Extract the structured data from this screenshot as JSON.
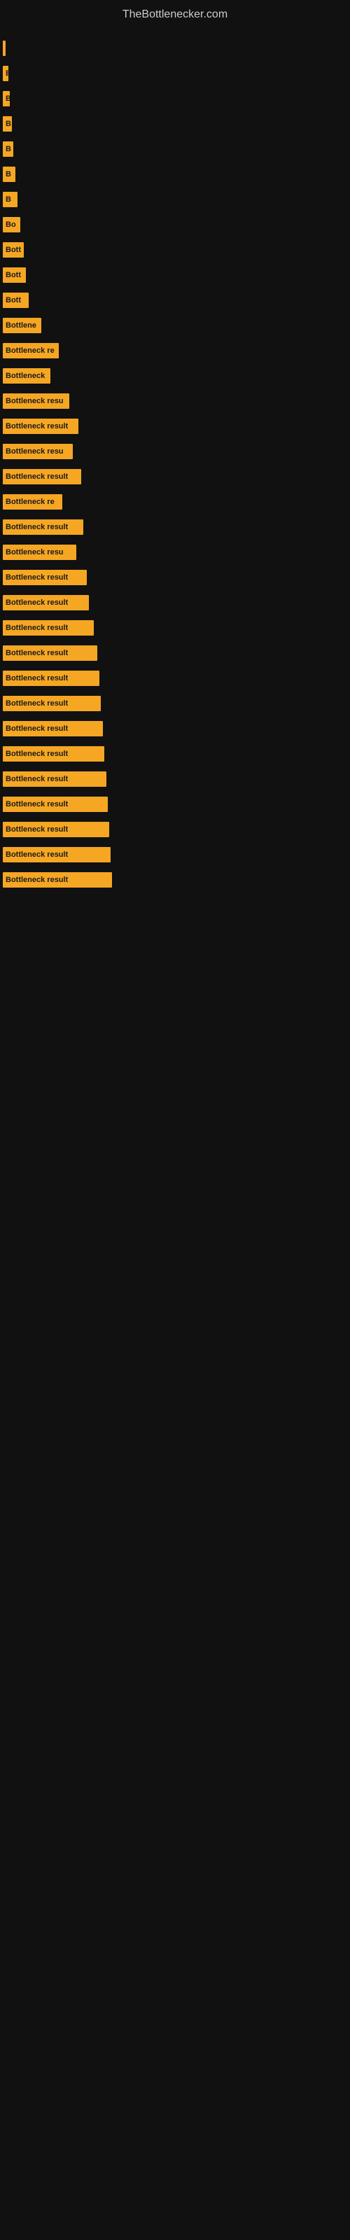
{
  "site": {
    "title": "TheBottlenecker.com"
  },
  "bars": [
    {
      "label": "|",
      "width": 4
    },
    {
      "label": "B",
      "width": 8
    },
    {
      "label": "B",
      "width": 10
    },
    {
      "label": "B",
      "width": 13
    },
    {
      "label": "B",
      "width": 15
    },
    {
      "label": "B",
      "width": 18
    },
    {
      "label": "B",
      "width": 21
    },
    {
      "label": "Bo",
      "width": 25
    },
    {
      "label": "Bott",
      "width": 30
    },
    {
      "label": "Bott",
      "width": 33
    },
    {
      "label": "Bott",
      "width": 37
    },
    {
      "label": "Bottlene",
      "width": 55
    },
    {
      "label": "Bottleneck re",
      "width": 80
    },
    {
      "label": "Bottleneck",
      "width": 68
    },
    {
      "label": "Bottleneck resu",
      "width": 95
    },
    {
      "label": "Bottleneck result",
      "width": 108
    },
    {
      "label": "Bottleneck resu",
      "width": 100
    },
    {
      "label": "Bottleneck result",
      "width": 112
    },
    {
      "label": "Bottleneck re",
      "width": 85
    },
    {
      "label": "Bottleneck result",
      "width": 115
    },
    {
      "label": "Bottleneck resu",
      "width": 105
    },
    {
      "label": "Bottleneck result",
      "width": 120
    },
    {
      "label": "Bottleneck result",
      "width": 123
    },
    {
      "label": "Bottleneck result",
      "width": 130
    },
    {
      "label": "Bottleneck result",
      "width": 135
    },
    {
      "label": "Bottleneck result",
      "width": 138
    },
    {
      "label": "Bottleneck result",
      "width": 140
    },
    {
      "label": "Bottleneck result",
      "width": 143
    },
    {
      "label": "Bottleneck result",
      "width": 145
    },
    {
      "label": "Bottleneck result",
      "width": 148
    },
    {
      "label": "Bottleneck result",
      "width": 150
    },
    {
      "label": "Bottleneck result",
      "width": 152
    },
    {
      "label": "Bottleneck result",
      "width": 154
    },
    {
      "label": "Bottleneck result",
      "width": 156
    }
  ]
}
